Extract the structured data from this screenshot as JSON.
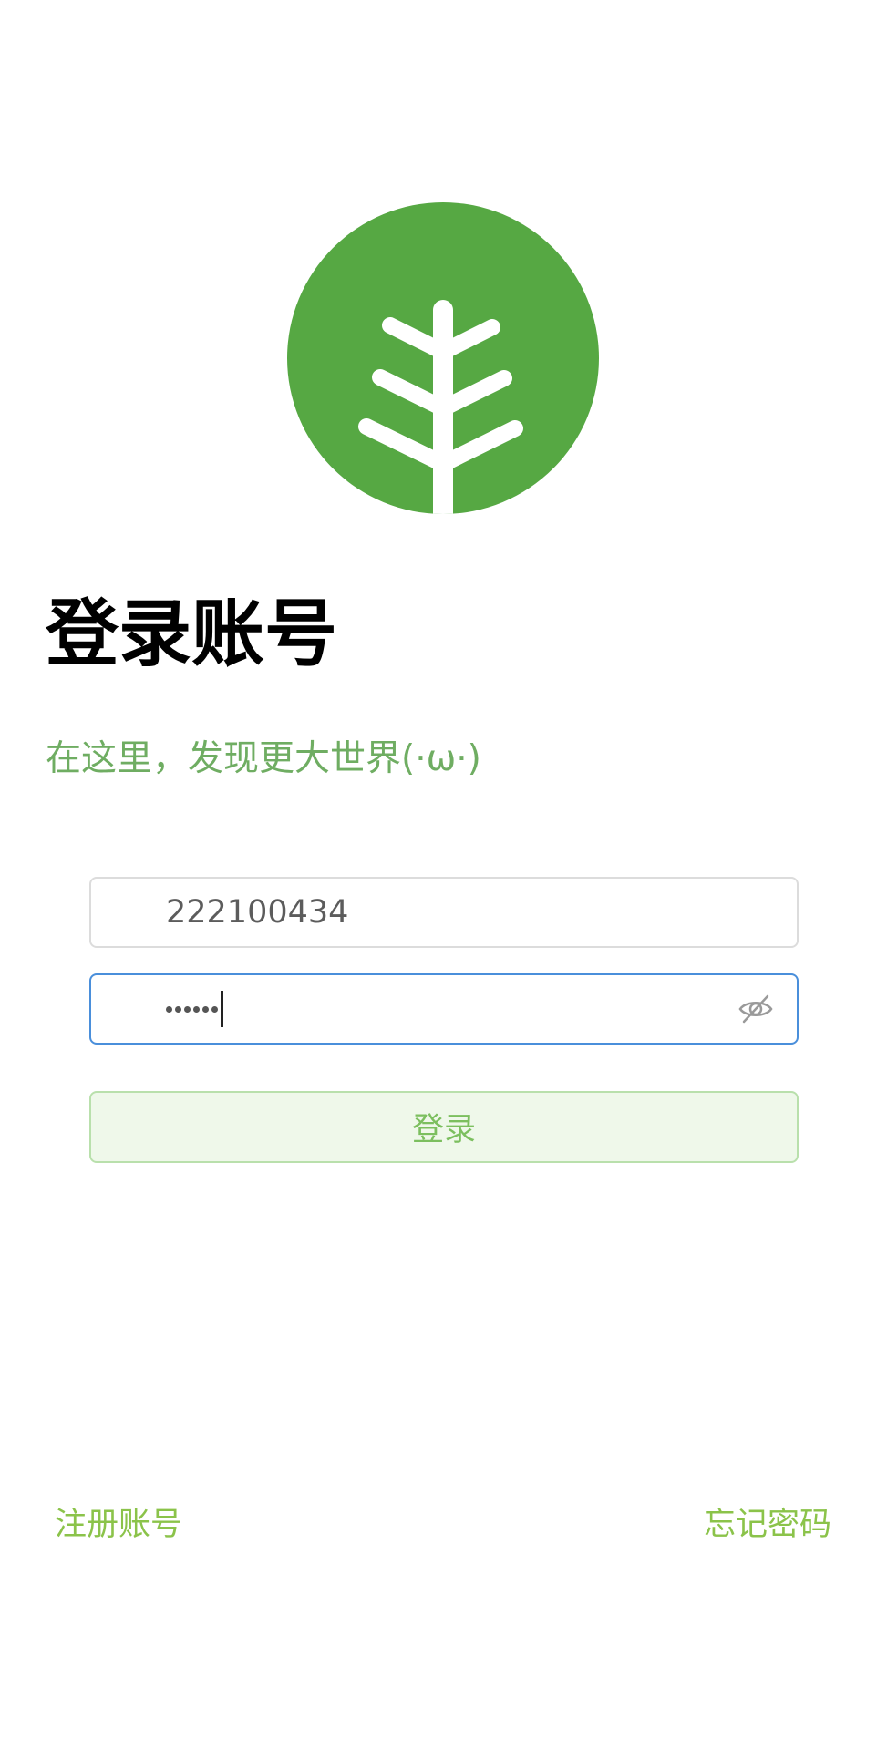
{
  "brand": {
    "logo_icon": "tree-logo-icon",
    "logo_color": "#56a843"
  },
  "login": {
    "title": "登录账号",
    "subtitle": "在这里，发现更大世界(·ω·)",
    "username": {
      "value": "222100434"
    },
    "password": {
      "masked_length": 6,
      "toggle_icon": "eye-off-icon"
    },
    "submit_label": "登录"
  },
  "footer": {
    "register_label": "注册账号",
    "forgot_label": "忘记密码"
  },
  "colors": {
    "accent_green": "#8bc34a",
    "subtitle_green": "#6fad62",
    "focus_blue": "#4a8fdb",
    "button_bg": "#eff8ea"
  }
}
